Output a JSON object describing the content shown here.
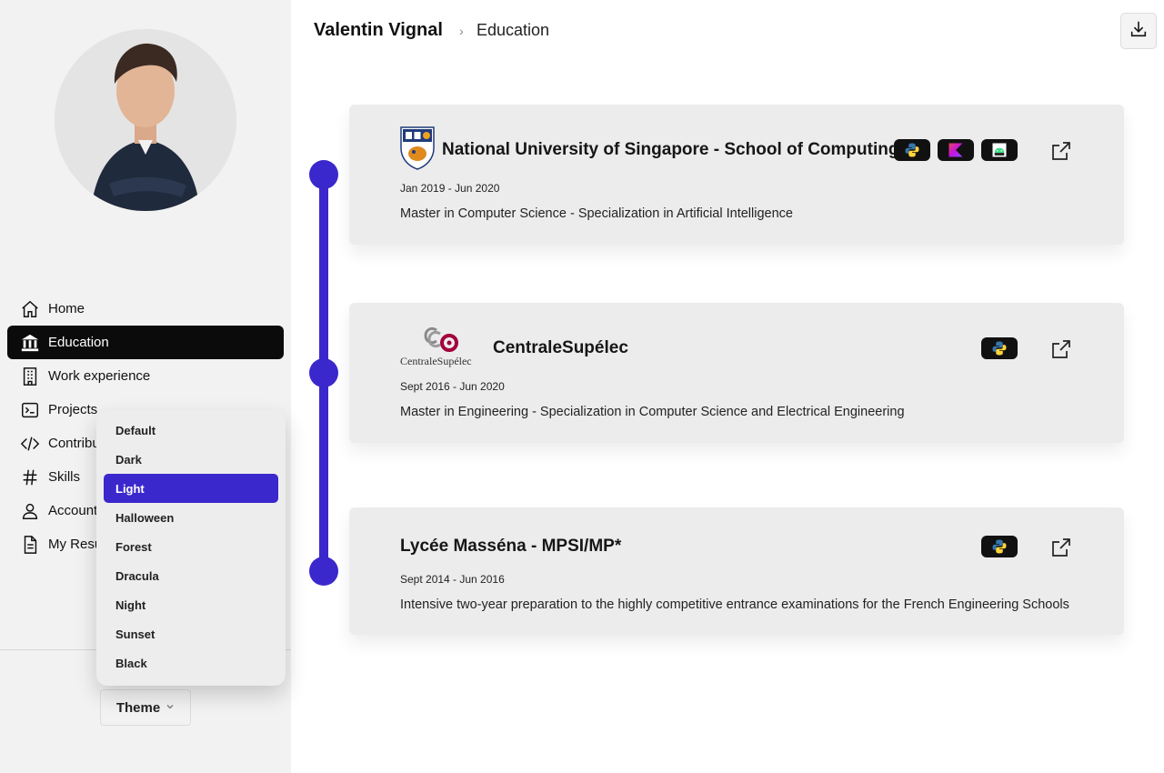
{
  "header": {
    "name": "Valentin Vignal",
    "separator": "›",
    "page": "Education"
  },
  "nav": [
    {
      "label": "Home",
      "icon": "home-icon"
    },
    {
      "label": "Education",
      "icon": "bank-icon",
      "active": true
    },
    {
      "label": "Work experience",
      "icon": "building-icon"
    },
    {
      "label": "Projects",
      "icon": "terminal-icon"
    },
    {
      "label": "Contribu",
      "icon": "code-icon"
    },
    {
      "label": "Skills",
      "icon": "hash-icon"
    },
    {
      "label": "Account",
      "icon": "user-icon"
    },
    {
      "label": "My Resu",
      "icon": "document-icon"
    }
  ],
  "theme": {
    "button_label": "Theme",
    "selected": "Light",
    "options": [
      "Default",
      "Dark",
      "Light",
      "Halloween",
      "Forest",
      "Dracula",
      "Night",
      "Sunset",
      "Black"
    ]
  },
  "education": [
    {
      "title": "National University of Singapore - School of Computing",
      "dates": "Jan 2019 - Jun 2020",
      "description": "Master in Computer Science - Specialization in Artificial Intelligence",
      "logo": "nus-crest-logo",
      "tags": [
        "python-icon",
        "kotlin-icon",
        "android-icon"
      ]
    },
    {
      "title": "CentraleSupélec",
      "dates": "Sept 2016 - Jun 2020",
      "description": "Master in Engineering - Specialization in Computer Science and Electrical Engineering",
      "logo": "centralesupelec-logo",
      "logo_text": "CentraleSupélec",
      "tags": [
        "python-icon"
      ]
    },
    {
      "title": "Lycée Masséna - MPSI/MP*",
      "dates": "Sept 2014 - Jun 2016",
      "description": "Intensive two-year preparation to the highly competitive entrance examinations for the French Engineering Schools",
      "tags": [
        "python-icon"
      ]
    }
  ],
  "colors": {
    "accent": "#3b28cc",
    "sidebar_bg": "#f2f2f2",
    "card_bg": "#ececec",
    "active_nav": "#0b0b0b"
  }
}
